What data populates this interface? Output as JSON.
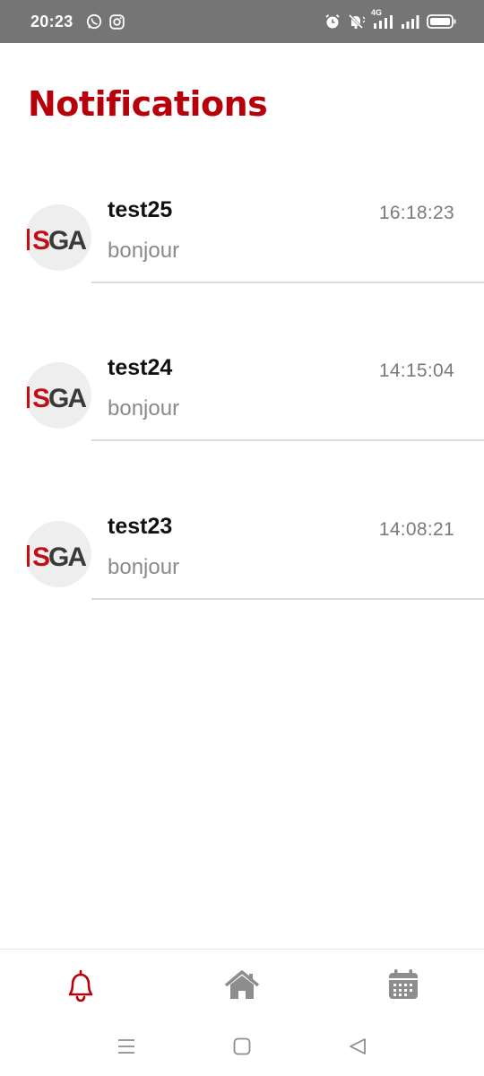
{
  "status_bar": {
    "time": "20:23",
    "network_label": "4G",
    "left_icons": [
      "whatsapp-icon",
      "instagram-icon"
    ],
    "right_icons": [
      "alarm-icon",
      "silent-icon",
      "signal-icon",
      "signal-icon",
      "battery-icon"
    ]
  },
  "page": {
    "title": "Notifications"
  },
  "notifications": [
    {
      "title": "test25",
      "body": "bonjour",
      "time": "16:18:23",
      "avatar": "ISGA"
    },
    {
      "title": "test24",
      "body": "bonjour",
      "time": "14:15:04",
      "avatar": "ISGA"
    },
    {
      "title": "test23",
      "body": "bonjour",
      "time": "14:08:21",
      "avatar": "ISGA"
    }
  ],
  "bottom_nav": {
    "items": [
      "bell-icon",
      "home-icon",
      "calendar-icon"
    ],
    "active": "bell-icon",
    "accent_color": "#b8000b",
    "inactive_color": "#8d8d8d"
  },
  "system_nav": [
    "menu-icon",
    "home-square-icon",
    "back-icon"
  ]
}
